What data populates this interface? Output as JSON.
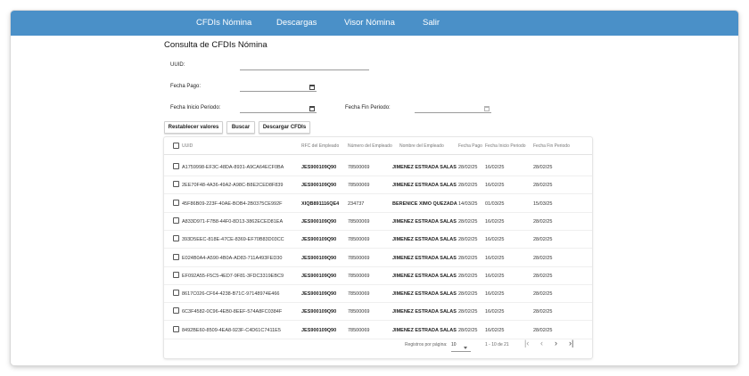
{
  "nav": {
    "items": [
      "CFDIs Nómina",
      "Descargas",
      "Visor Nómina",
      "Salir"
    ]
  },
  "page": {
    "title": "Consulta de CFDIs Nómina"
  },
  "filters": {
    "uuid_label": "UUID:",
    "fecha_pago_label": "Fecha Pago:",
    "fecha_inicio_label": "Fecha Inicio Periodo:",
    "fecha_fin_label": "Fecha Fin Periodo:"
  },
  "buttons": {
    "reset": "Restablecer valores",
    "search": "Buscar",
    "download": "Descargar CFDIs"
  },
  "table": {
    "headers": [
      "UUID",
      "RFC del Empleado",
      "Número del Empleado",
      "Nombre del Empleado",
      "Fecha Pago",
      "Fecha Inicio Periodo",
      "Fecha Fin Periodo"
    ],
    "rows": [
      {
        "uuid": "A1759998-EF3C-48DA-8931-A9CA64ECF0BA",
        "rfc": "JES900109Q90",
        "num": "78500069",
        "name": "JIMENEZ ESTRADA SALAS",
        "pago": "28/02/25",
        "inicio": "16/02/25",
        "fin": "28/02/25"
      },
      {
        "uuid": "2EE70F48-4A36-49A2-A98C-B8E2CED8F839",
        "rfc": "JES900109Q90",
        "num": "78500069",
        "name": "JIMENEZ ESTRADA SALAS",
        "pago": "28/02/25",
        "inicio": "16/02/25",
        "fin": "28/02/25"
      },
      {
        "uuid": "45F86B09-223F-40AE-BOB4-2B0375CE992F",
        "rfc": "XIQB891116QE4",
        "num": "234737",
        "name": "BERENICE XIMO QUEZADA",
        "pago": "14/03/25",
        "inicio": "01/03/25",
        "fin": "15/03/25"
      },
      {
        "uuid": "A833D971-F7B8-44F0-8D13-3862ECED81EA",
        "rfc": "JES900109Q90",
        "num": "78500069",
        "name": "JIMENEZ ESTRADA SALAS",
        "pago": "28/02/25",
        "inicio": "16/02/25",
        "fin": "28/02/25"
      },
      {
        "uuid": "393D5EEC-818E-47CE-8369-EF70B83D03CC",
        "rfc": "JES900109Q90",
        "num": "78500069",
        "name": "JIMENEZ ESTRADA SALAS",
        "pago": "28/02/25",
        "inicio": "16/02/25",
        "fin": "28/02/25"
      },
      {
        "uuid": "E024B0A4-A590-4B0A-AD83-711A493FED30",
        "rfc": "JES900109Q90",
        "num": "78500069",
        "name": "JIMENEZ ESTRADA SALAS",
        "pago": "28/02/25",
        "inicio": "16/02/25",
        "fin": "28/02/25"
      },
      {
        "uuid": "EF092A55-F5C5-4ED7-9F81-3FDC3319EBC9",
        "rfc": "JES900109Q90",
        "num": "78500069",
        "name": "JIMENEZ ESTRADA SALAS",
        "pago": "28/02/25",
        "inicio": "16/02/25",
        "fin": "28/02/25"
      },
      {
        "uuid": "8617C026-CF64-4238-B71C-97148974E466",
        "rfc": "JES900109Q90",
        "num": "78500069",
        "name": "JIMENEZ ESTRADA SALAS",
        "pago": "28/02/25",
        "inicio": "16/02/25",
        "fin": "28/02/25"
      },
      {
        "uuid": "6C3F4582-0C96-4EB0-8EEF-574A8FC0384F",
        "rfc": "JES900109Q90",
        "num": "78500069",
        "name": "JIMENEZ ESTRADA SALAS",
        "pago": "28/02/25",
        "inicio": "16/02/25",
        "fin": "28/02/25"
      },
      {
        "uuid": "8492BE60-8509-4EA8-923F-C4D61C7411E5",
        "rfc": "JES900109Q90",
        "num": "78500069",
        "name": "JIMENEZ ESTRADA SALAS",
        "pago": "28/02/25",
        "inicio": "16/02/25",
        "fin": "28/02/25"
      }
    ]
  },
  "pagination": {
    "rows_per_page_label": "Registros por página:",
    "rows_per_page_value": "10",
    "range": "1 - 10 de 21",
    "first_icon": "first-page-icon",
    "prev_icon": "prev-page-icon",
    "next_icon": "next-page-icon",
    "last_icon": "last-page-icon"
  },
  "colors": {
    "nav": "#4a90c8"
  }
}
